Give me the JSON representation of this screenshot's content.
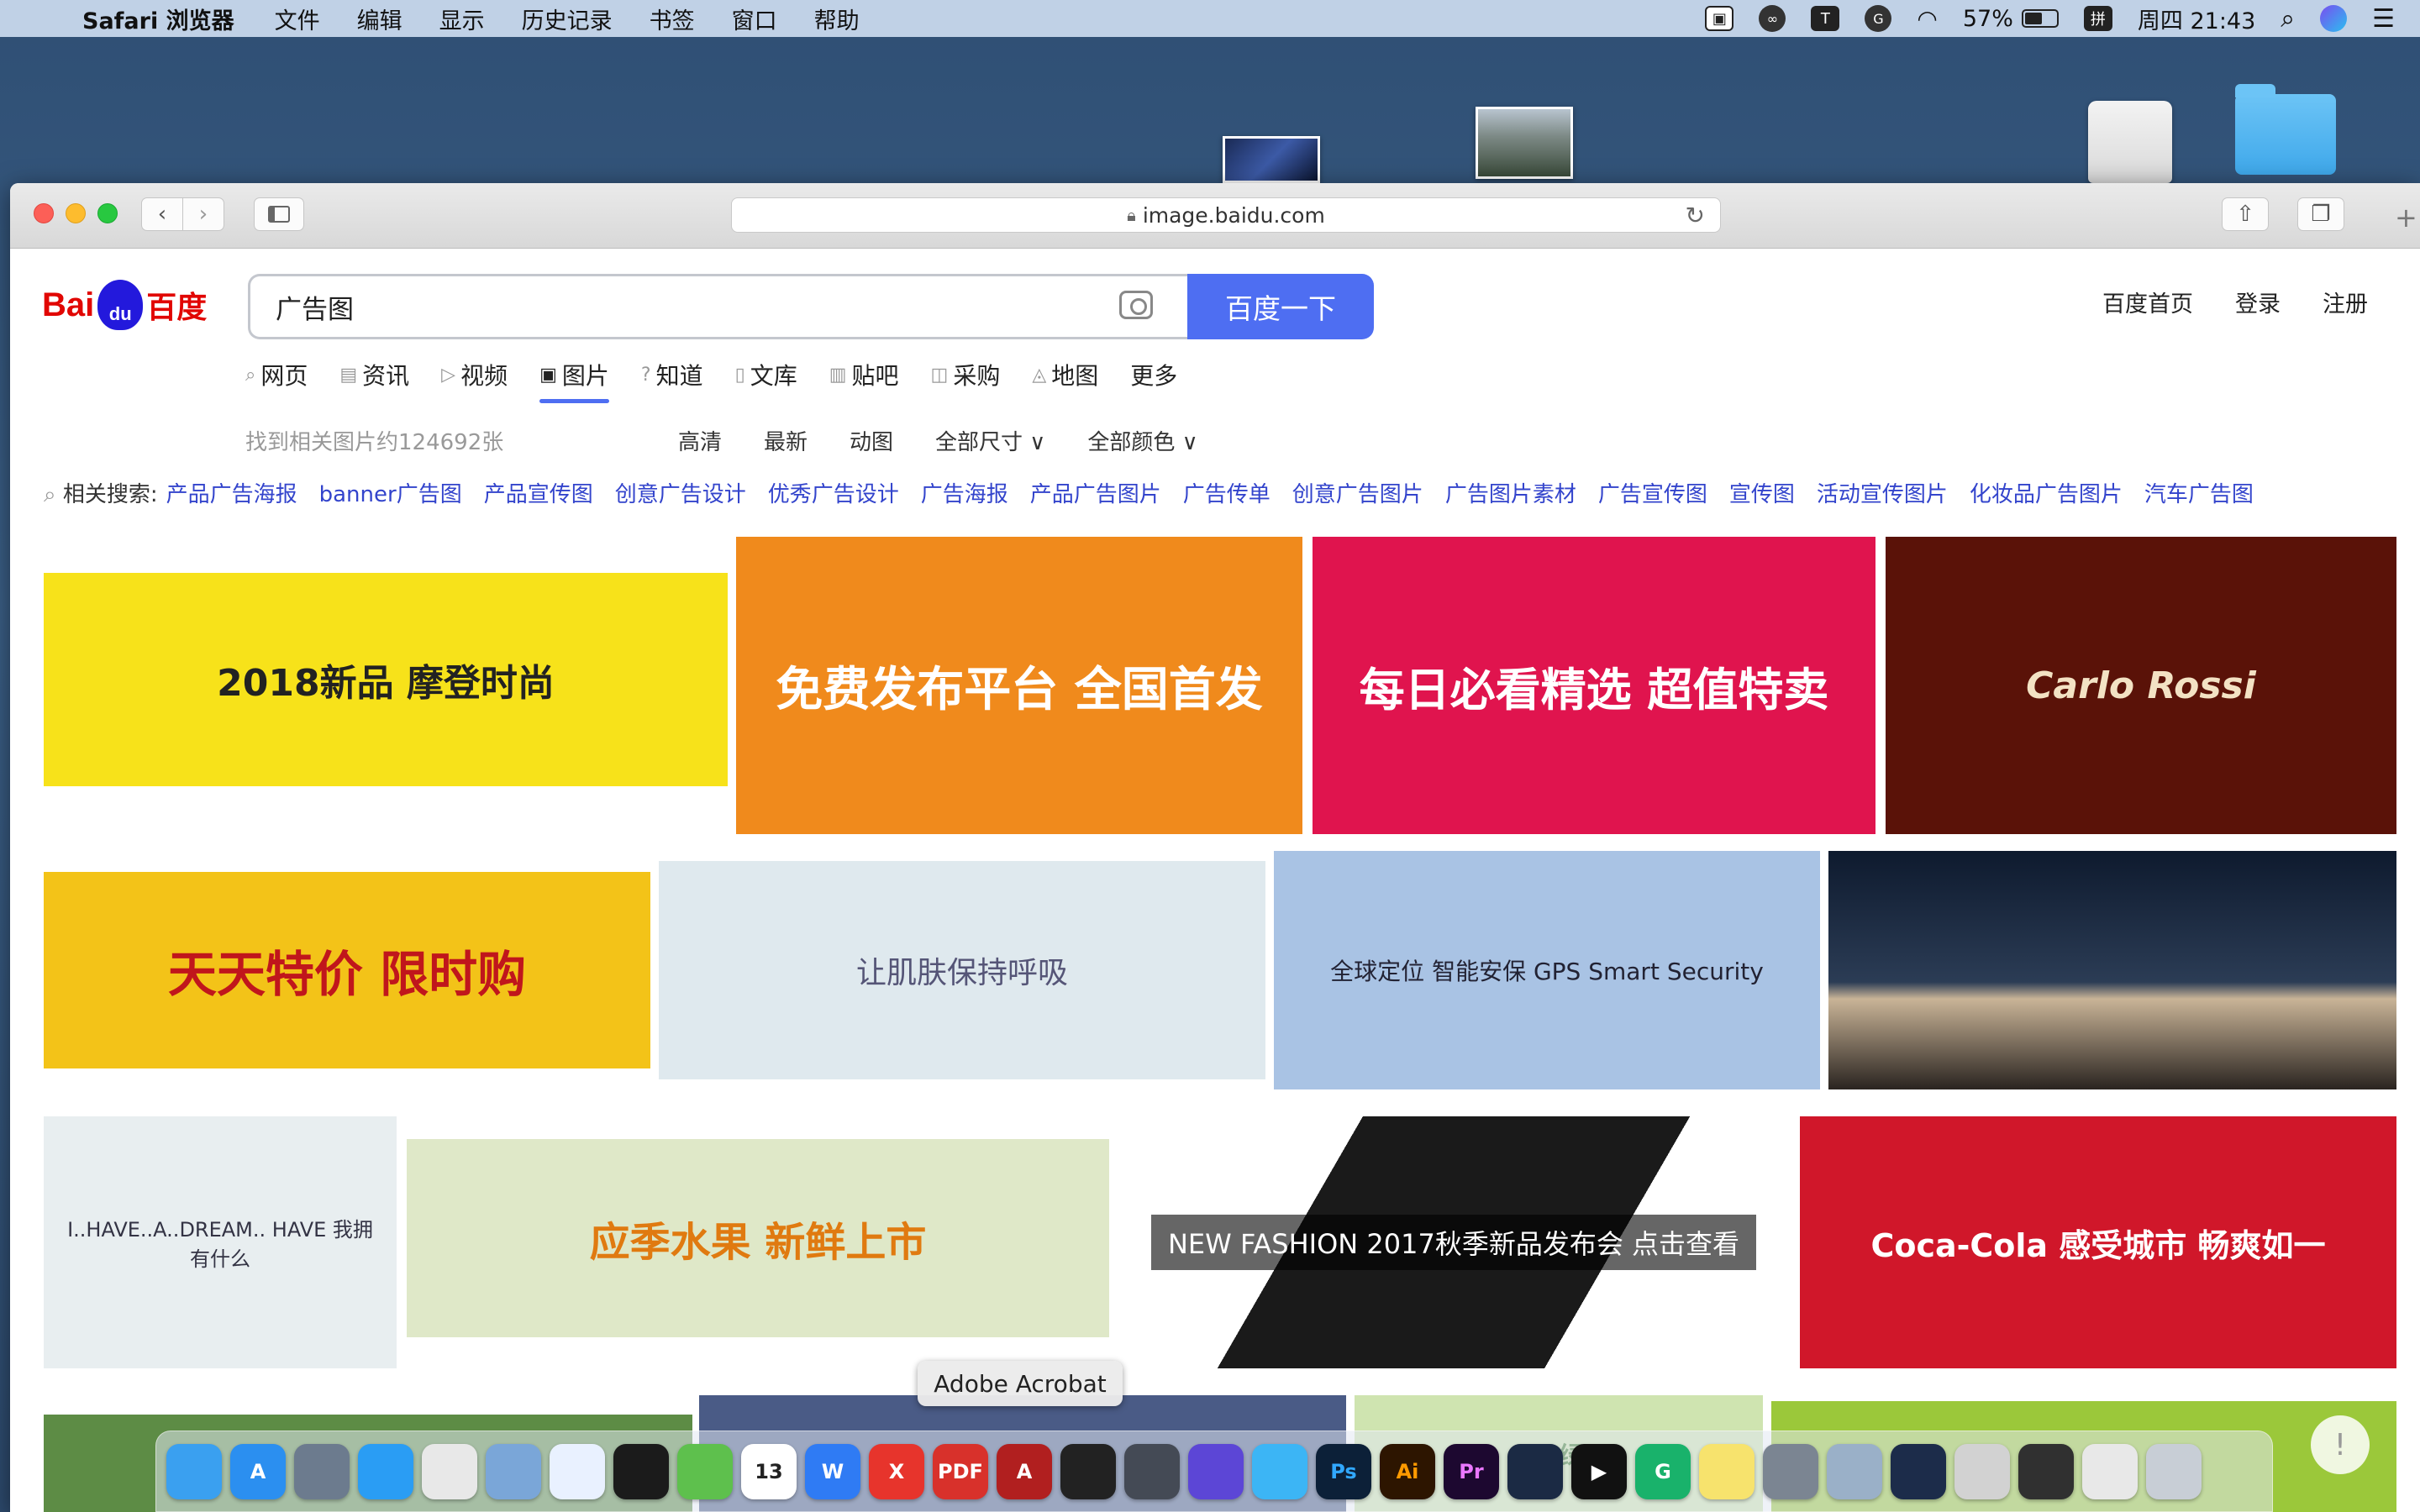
{
  "menubar": {
    "app_name": "Safari 浏览器",
    "items": [
      "文件",
      "编辑",
      "显示",
      "历史记录",
      "书签",
      "窗口",
      "帮助"
    ],
    "tray_letter_t": "T",
    "tray_letter_g": "G",
    "battery_percent": "57%",
    "battery_level": 0.57,
    "input_method": "拼",
    "clock": "周四 21:43"
  },
  "safari": {
    "url": "image.baidu.com"
  },
  "baidu": {
    "logo_bai": "Bai",
    "logo_du": "du",
    "logo_name": "百度",
    "search_query": "广告图",
    "search_button": "百度一下",
    "top_links": [
      "百度首页",
      "登录",
      "注册"
    ],
    "nav_tabs": [
      "网页",
      "资讯",
      "视频",
      "图片",
      "知道",
      "文库",
      "贴吧",
      "采购",
      "地图",
      "更多"
    ],
    "result_count": "找到相关图片约124692张",
    "filters": [
      "高清",
      "最新",
      "动图",
      "全部尺寸 ∨",
      "全部颜色 ∨"
    ],
    "related_label": "相关搜索:",
    "related_links": [
      "产品广告海报",
      "banner广告图",
      "产品宣传图",
      "创意广告设计",
      "优秀广告设计",
      "广告海报",
      "产品广告图片",
      "广告传单",
      "创意广告图片",
      "广告图片素材",
      "广告宣传图",
      "宣传图",
      "活动宣传图片",
      "化妆品广告图片",
      "汽车广告图"
    ]
  },
  "images": [
    {
      "text": "2018新品 摩登时尚",
      "bg": "#f7e21a",
      "fg": "#222"
    },
    {
      "text": "免费发布平台 全国首发",
      "bg": "#f08a1c",
      "fg": "#fff"
    },
    {
      "text": "每日必看精选 超值特卖",
      "bg": "#e0144e",
      "fg": "#fff"
    },
    {
      "text": "Carlo Rossi",
      "bg": "#5a1208",
      "fg": "#f3e2c4"
    },
    {
      "text": "天天特价 限时购",
      "bg": "#f3c318",
      "fg": "#c0161c"
    },
    {
      "text": "让肌肤保持呼吸",
      "bg": "#dfe9ee",
      "fg": "#557"
    },
    {
      "text": "全球定位 智能安保 GPS Smart Security",
      "bg": "#a9c3e4",
      "fg": "#223"
    },
    {
      "text": "",
      "bg": "#1d2533",
      "fg": "#fff"
    },
    {
      "text": "I..HAVE..A..DREAM.. HAVE 我拥有什么",
      "bg": "#e8eef0",
      "fg": "#334"
    },
    {
      "text": "应季水果 新鲜上市",
      "bg": "#dfe8c8",
      "fg": "#e07a10"
    },
    {
      "text": "NEW FASHION 2017秋季新品发布会 点击查看",
      "bg": "#2a2a2a",
      "fg": "#fff"
    },
    {
      "text": "Coca-Cola 感受城市 畅爽如一",
      "bg": "#d0172a",
      "fg": "#fff"
    },
    {
      "text": "",
      "bg": "#5d8c45",
      "fg": "#fff"
    },
    {
      "text": "",
      "bg": "#4a5b86",
      "fg": "#fff"
    },
    {
      "text": "从绿",
      "bg": "#cfe4b0",
      "fg": "#3a7a2a"
    },
    {
      "text": "",
      "bg": "#9bc83a",
      "fg": "#fff"
    }
  ],
  "dock": {
    "tooltip": "Adobe Acrobat",
    "apps": [
      {
        "name": "finder",
        "bg": "#3aa0f0",
        "label": ""
      },
      {
        "name": "app-store",
        "bg": "#2b8ff0",
        "label": "A"
      },
      {
        "name": "launchpad",
        "bg": "#6c7b8e",
        "label": ""
      },
      {
        "name": "safari",
        "bg": "#2a9df4",
        "label": ""
      },
      {
        "name": "chrome",
        "bg": "#e8e8e8",
        "label": ""
      },
      {
        "name": "preview",
        "bg": "#7aa6d8",
        "label": ""
      },
      {
        "name": "baidu-netdisk",
        "bg": "#e9f1ff",
        "label": ""
      },
      {
        "name": "qq",
        "bg": "#1b1b1b",
        "label": ""
      },
      {
        "name": "wechat",
        "bg": "#5ec04d",
        "label": ""
      },
      {
        "name": "calendar",
        "bg": "#ffffff",
        "label": "13"
      },
      {
        "name": "wps",
        "bg": "#2f7bf4",
        "label": "W"
      },
      {
        "name": "xmind",
        "bg": "#e7342c",
        "label": "X"
      },
      {
        "name": "pdf-expert",
        "bg": "#d8312b",
        "label": "PDF"
      },
      {
        "name": "acrobat",
        "bg": "#b11f1f",
        "label": "A"
      },
      {
        "name": "screen-recorder",
        "bg": "#222222",
        "label": ""
      },
      {
        "name": "photo-booth",
        "bg": "#444a55",
        "label": ""
      },
      {
        "name": "downie",
        "bg": "#5c46d6",
        "label": ""
      },
      {
        "name": "xcode",
        "bg": "#3cb5f5",
        "label": ""
      },
      {
        "name": "photoshop",
        "bg": "#0c2038",
        "label": "Ps"
      },
      {
        "name": "illustrator",
        "bg": "#2d1500",
        "label": "Ai"
      },
      {
        "name": "premiere",
        "bg": "#1d0830",
        "label": "Pr"
      },
      {
        "name": "cinema4d",
        "bg": "#1b2a44",
        "label": ""
      },
      {
        "name": "infuse",
        "bg": "#111111",
        "label": "▶"
      },
      {
        "name": "grammarly",
        "bg": "#19b26b",
        "label": "G"
      },
      {
        "name": "notes",
        "bg": "#f7e36d",
        "label": ""
      },
      {
        "name": "system-preferences",
        "bg": "#7b8592",
        "label": ""
      },
      {
        "name": "image-capture",
        "bg": "#9ab0c8",
        "label": ""
      },
      {
        "name": "quicktime",
        "bg": "#1c2c4a",
        "label": ""
      },
      {
        "name": "recent-doc-1",
        "bg": "#d2d2d2",
        "label": ""
      },
      {
        "name": "recent-doc-2",
        "bg": "#303030",
        "label": ""
      },
      {
        "name": "recent-doc-3",
        "bg": "#e8e8e8",
        "label": ""
      },
      {
        "name": "trash",
        "bg": "#c8ced6",
        "label": ""
      }
    ],
    "badge": "!"
  }
}
